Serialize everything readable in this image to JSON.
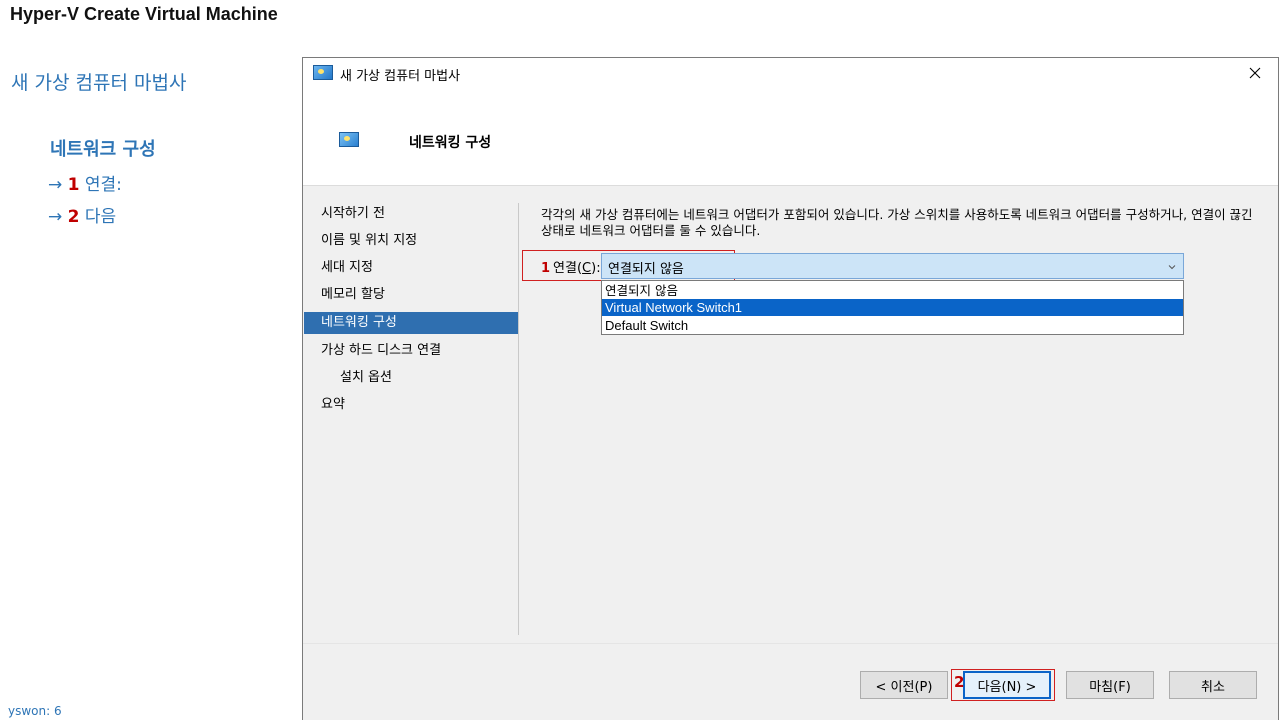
{
  "slide": {
    "title": "Hyper-V Create Virtual Machine",
    "subtitle": "새 가상 컴퓨터 마법사",
    "section": "네트워크 구성",
    "steps": [
      {
        "arrow": "→",
        "num": "1",
        "text": "연결:"
      },
      {
        "arrow": "→",
        "num": "2",
        "text": "다음"
      }
    ],
    "footer": "yswon:   6"
  },
  "dialog": {
    "title": "새 가상 컴퓨터 마법사",
    "close_icon": "close-icon",
    "header_title": "네트워킹 구성",
    "nav": [
      {
        "label": "시작하기 전",
        "sub": false,
        "active": false
      },
      {
        "label": "이름 및 위치 지정",
        "sub": false,
        "active": false
      },
      {
        "label": "세대 지정",
        "sub": false,
        "active": false
      },
      {
        "label": "메모리 할당",
        "sub": false,
        "active": false
      },
      {
        "label": "네트워킹 구성",
        "sub": false,
        "active": true
      },
      {
        "label": "가상 하드 디스크 연결",
        "sub": false,
        "active": false
      },
      {
        "label": "설치 옵션",
        "sub": true,
        "active": false
      },
      {
        "label": "요약",
        "sub": false,
        "active": false
      }
    ],
    "description": "각각의 새 가상 컴퓨터에는 네트워크 어댑터가 포함되어 있습니다. 가상 스위치를 사용하도록 네트워크 어댑터를 구성하거나, 연결이 끊긴 상태로 네트워크 어댑터를 둘 수 있습니다.",
    "connection": {
      "marker": "1",
      "label_prefix": "연결(",
      "label_key": "C",
      "label_suffix": "):",
      "value": "연결되지 않음",
      "options": [
        "연결되지 않음",
        "Virtual Network Switch1",
        "Default Switch"
      ],
      "highlighted_option": "Virtual Network Switch1"
    },
    "buttons": {
      "prev": "< 이전(P)",
      "next": "다음(N) >",
      "finish": "마침(F)",
      "cancel": "취소"
    },
    "next_marker": "2"
  },
  "colors": {
    "accent_blue": "#2e75b6",
    "marker_red": "#c00000",
    "selection_blue": "#0a64c8"
  }
}
